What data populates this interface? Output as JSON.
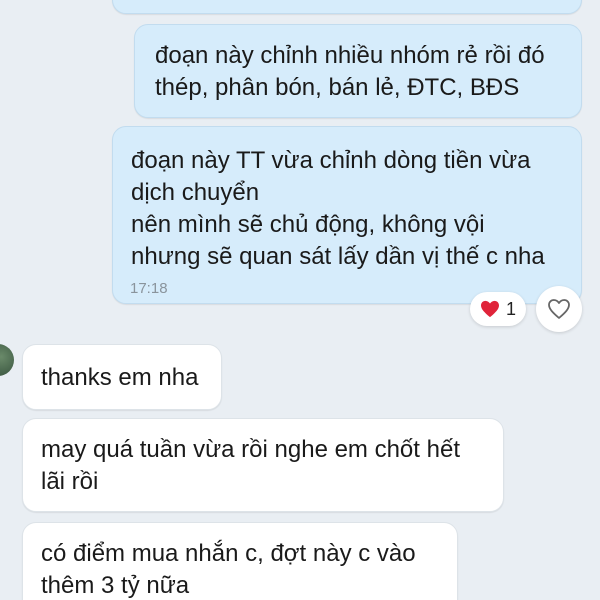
{
  "messages": {
    "sent_1": {
      "lines": [
        "đoạn này chỉnh nhiều nhóm rẻ rồi đó",
        "thép, phân bón, bán lẻ, ĐTC, BĐS"
      ]
    },
    "sent_2": {
      "lines": [
        "đoạn này TT vừa chỉnh dòng tiền vừa",
        "dịch chuyển",
        "nên mình sẽ chủ động, không vội",
        "nhưng sẽ quan sát lấy dần vị thế c nha"
      ],
      "time": "17:18",
      "reaction_count": "1",
      "reaction_icon": "red-heart-icon",
      "react_button_icon": "heart-outline-icon"
    },
    "recv_1": {
      "lines": [
        "thanks em nha"
      ]
    },
    "recv_2": {
      "lines": [
        "may quá tuần vừa rồi nghe em chốt hết",
        "lãi rồi"
      ]
    },
    "recv_3": {
      "lines": [
        "có điểm mua nhắn c, đợt này c vào",
        "thêm 3 tỷ nữa"
      ]
    }
  },
  "colors": {
    "sent_bubble": "#d6ecfb",
    "received_bubble": "#ffffff",
    "background": "#e9eef3",
    "heart": "#e0243a"
  }
}
